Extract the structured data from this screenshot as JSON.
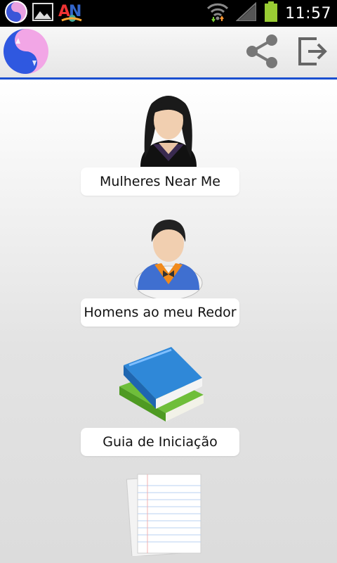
{
  "status_bar": {
    "time": "11:57",
    "notification_icons": [
      "app-notification-icon",
      "image-icon",
      "an-app-icon"
    ],
    "system_icons": [
      "wifi-icon",
      "signal-icon",
      "battery-icon"
    ]
  },
  "action_bar": {
    "logo_icon": "cat-yin-yang-logo",
    "actions": [
      "share-icon",
      "exit-icon"
    ],
    "accent_color": "#1a4fd0"
  },
  "menu": {
    "items": [
      {
        "label": "Mulheres Near Me",
        "icon": "woman-avatar-icon"
      },
      {
        "label": "Homens ao meu Redor",
        "icon": "man-avatar-icon"
      },
      {
        "label": "Guia de Iniciação",
        "icon": "books-icon"
      },
      {
        "label": "",
        "icon": "notepad-icon"
      }
    ]
  }
}
